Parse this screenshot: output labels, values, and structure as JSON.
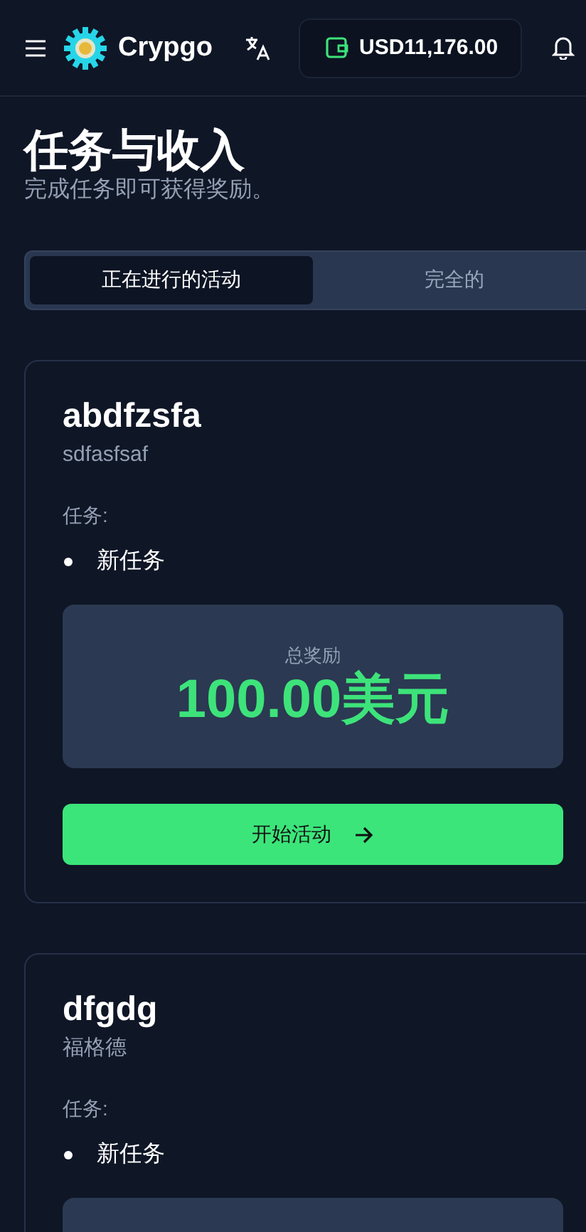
{
  "header": {
    "brand": "Crypgo",
    "balance": "USD11,176.00"
  },
  "page": {
    "title": "任务与收入",
    "subtitle": "完成任务即可获得奖励。"
  },
  "tabs": [
    {
      "label": "正在进行的活动",
      "selected": true
    },
    {
      "label": "完全的",
      "selected": false
    }
  ],
  "campaigns": [
    {
      "title": "abdfzsfa",
      "description": "sdfasfsaf",
      "tasks_label": "任务:",
      "tasks": [
        "新任务"
      ],
      "reward_label": "总奖励",
      "reward": "100.00美元",
      "button": "开始活动"
    },
    {
      "title": "dfgdg",
      "description": "福格德",
      "tasks_label": "任务:",
      "tasks": [
        "新任务"
      ]
    }
  ]
}
